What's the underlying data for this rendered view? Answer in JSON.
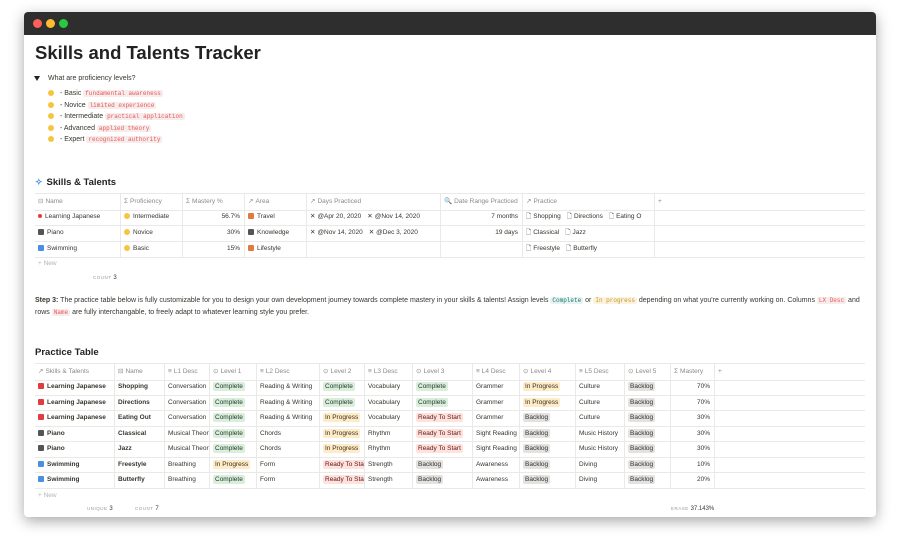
{
  "page": {
    "title": "Skills and Talents Tracker",
    "toggle_title": "What are proficiency levels?",
    "levels": [
      {
        "name": " - Basic ",
        "note": "fundamental awareness"
      },
      {
        "name": " - Novice ",
        "note": "limited experience"
      },
      {
        "name": " - Intermediate ",
        "note": "practical application"
      },
      {
        "name": " - Advanced ",
        "note": "applied theory"
      },
      {
        "name": " - Expert ",
        "note": "recognized authority"
      }
    ]
  },
  "skills": {
    "title": "Skills & Talents",
    "headers": [
      "Name",
      "Proficiency",
      "Mastery %",
      "Area",
      "Days Practiced",
      "Date Range Practiced",
      "Practice",
      "+"
    ],
    "rows": [
      {
        "name": "Learning Japanese",
        "prof": "Intermediate",
        "mastery": "56.7%",
        "area": "Travel",
        "d1": "@Apr 20, 2020",
        "d2": "@Nov 14, 2020",
        "range": "7 months",
        "p1": "Shopping",
        "p2": "Directions",
        "p3": "Eating O"
      },
      {
        "name": "Piano",
        "prof": "Novice",
        "mastery": "30%",
        "area": "Knowledge",
        "d1": "@Nov 14, 2020",
        "d2": "@Dec 3, 2020",
        "range": "19 days",
        "p1": "Classical",
        "p2": "Jazz",
        "p3": ""
      },
      {
        "name": "Swimming",
        "prof": "Basic",
        "mastery": "15%",
        "area": "Lifestyle",
        "d1": "",
        "d2": "",
        "range": "",
        "p1": "Freestyle",
        "p2": "Butterfly",
        "p3": ""
      }
    ],
    "new_label": "+ New",
    "count_label": "COUNT",
    "count_value": "3"
  },
  "step": {
    "bold": "Step 3:",
    "text1": " The practice table below is fully customizable for you to design your own development journey towards complete mastery in your skills & talents! Assign levels ",
    "code1": "Complete",
    "text2": " or ",
    "code2": "In progress",
    "text3": " depending on what you're currently working on. Columns ",
    "code3": "LX Desc",
    "text4": " and rows ",
    "code4": "Name",
    "text5": " are fully interchangable, to freely adapt to whatever learning style you prefer."
  },
  "practice": {
    "title": "Practice Table",
    "headers": [
      "Skills & Talents",
      "Name",
      "L1 Desc",
      "Level 1",
      "L2 Desc",
      "Level 2",
      "L3 Desc",
      "Level 3",
      "L4 Desc",
      "Level 4",
      "L5 Desc",
      "Level 5",
      "Mastery",
      "+"
    ],
    "rows": [
      {
        "skill": "Learning Japanese",
        "name": "Shopping",
        "l1d": "Conversation",
        "l1": "Complete",
        "l2d": "Reading & Writing",
        "l2": "Complete",
        "l3d": "Vocabulary",
        "l3": "Complete",
        "l4d": "Grammer",
        "l4": "In Progress",
        "l5d": "Culture",
        "l5": "Backlog",
        "m": "70%"
      },
      {
        "skill": "Learning Japanese",
        "name": "Directions",
        "l1d": "Conversation",
        "l1": "Complete",
        "l2d": "Reading & Writing",
        "l2": "Complete",
        "l3d": "Vocabulary",
        "l3": "Complete",
        "l4d": "Grammer",
        "l4": "In Progress",
        "l5d": "Culture",
        "l5": "Backlog",
        "m": "70%"
      },
      {
        "skill": "Learning Japanese",
        "name": "Eating Out",
        "l1d": "Conversation",
        "l1": "Complete",
        "l2d": "Reading & Writing",
        "l2": "In Progress",
        "l3d": "Vocabulary",
        "l3": "Ready To Start",
        "l4d": "Grammer",
        "l4": "Backlog",
        "l5d": "Culture",
        "l5": "Backlog",
        "m": "30%"
      },
      {
        "skill": "Piano",
        "name": "Classical",
        "l1d": "Musical Theory",
        "l1": "Complete",
        "l2d": "Chords",
        "l2": "In Progress",
        "l3d": "Rhythm",
        "l3": "Ready To Start",
        "l4d": "Sight Reading",
        "l4": "Backlog",
        "l5d": "Music History",
        "l5": "Backlog",
        "m": "30%"
      },
      {
        "skill": "Piano",
        "name": "Jazz",
        "l1d": "Musical Theory",
        "l1": "Complete",
        "l2d": "Chords",
        "l2": "In Progress",
        "l3d": "Rhythm",
        "l3": "Ready To Start",
        "l4d": "Sight Reading",
        "l4": "Backlog",
        "l5d": "Music History",
        "l5": "Backlog",
        "m": "30%"
      },
      {
        "skill": "Swimming",
        "name": "Freestyle",
        "l1d": "Breathing",
        "l1": "In Progress",
        "l2d": "Form",
        "l2": "Ready To Start",
        "l3d": "Strength",
        "l3": "Backlog",
        "l4d": "Awareness",
        "l4": "Backlog",
        "l5d": "Diving",
        "l5": "Backlog",
        "m": "10%"
      },
      {
        "skill": "Swimming",
        "name": "Butterfly",
        "l1d": "Breathing",
        "l1": "Complete",
        "l2d": "Form",
        "l2": "Ready To Start",
        "l3d": "Strength",
        "l3": "Backlog",
        "l4d": "Awareness",
        "l4": "Backlog",
        "l5d": "Diving",
        "l5": "Backlog",
        "m": "20%"
      }
    ],
    "new_label": "+ New",
    "unique_label": "UNIQUE",
    "unique_value": "3",
    "count_label": "COUNT",
    "count_value": "7",
    "erase_label": "ERASE",
    "erase_value": "37.143%"
  }
}
